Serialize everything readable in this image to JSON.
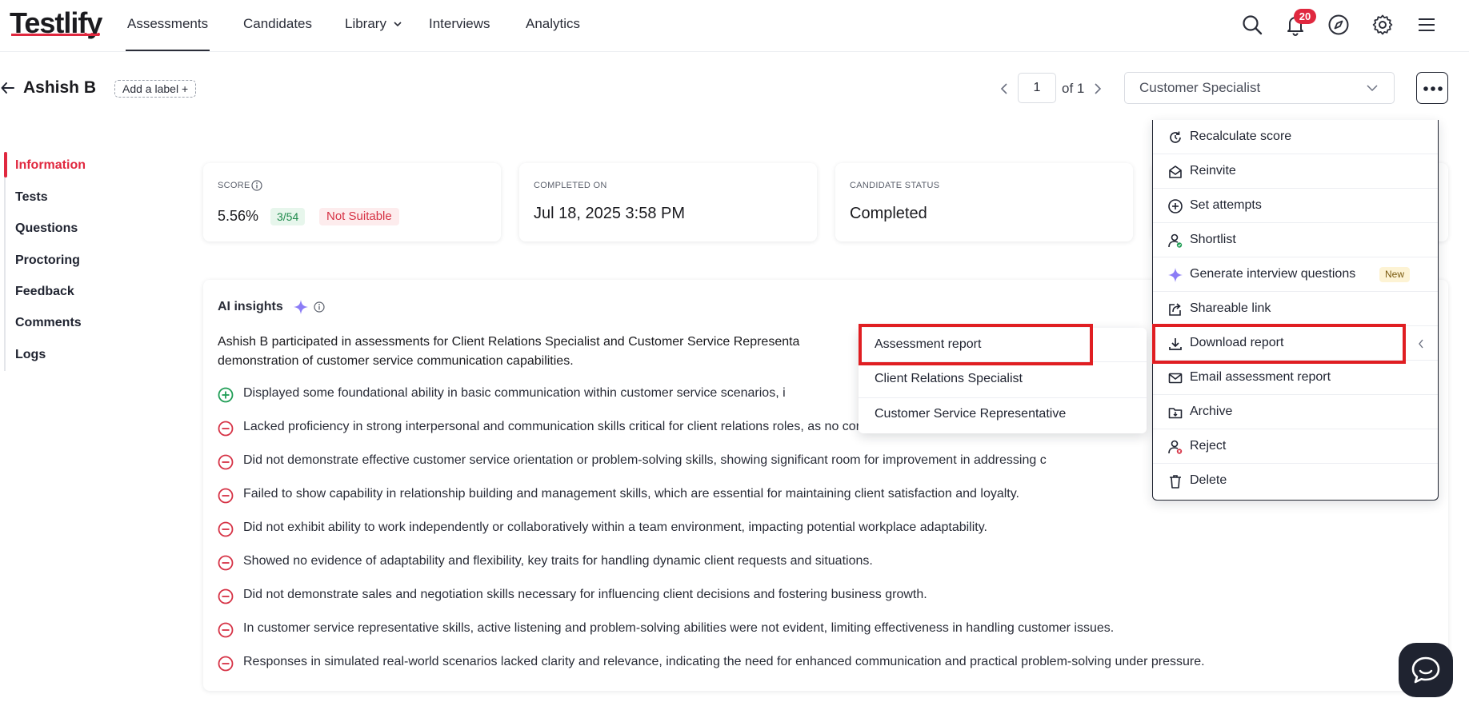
{
  "brand": {
    "name": "Testlify",
    "accent": "#e0283f"
  },
  "nav": {
    "items": [
      {
        "label": "Assessments",
        "active": true
      },
      {
        "label": "Candidates"
      },
      {
        "label": "Library"
      },
      {
        "label": "Interviews"
      },
      {
        "label": "Analytics"
      }
    ],
    "notifications_count": "20",
    "icons": [
      "search-icon",
      "bell-icon",
      "compass-icon",
      "gear-icon",
      "hamburger-menu-icon"
    ]
  },
  "header": {
    "candidate_name": "Ashish B",
    "add_label": "Add a label +",
    "pager": {
      "current": "1",
      "of_label": "of 1"
    },
    "role_select": "Customer Specialist"
  },
  "sidebar": {
    "items": [
      {
        "label": "Information",
        "active": true
      },
      {
        "label": "Tests"
      },
      {
        "label": "Questions"
      },
      {
        "label": "Proctoring"
      },
      {
        "label": "Feedback"
      },
      {
        "label": "Comments"
      },
      {
        "label": "Logs"
      }
    ]
  },
  "cards": {
    "score": {
      "label": "SCORE",
      "value": "5.56%",
      "ratio": "3/54",
      "status": "Not Suitable"
    },
    "completed_on": {
      "label": "COMPLETED ON",
      "value": "Jul 18, 2025 3:58 PM"
    },
    "candidate_status": {
      "label": "CANDIDATE STATUS",
      "value": "Completed"
    }
  },
  "insights": {
    "title": "AI insights",
    "summary_line1": "Ashish B participated in assessments for Client Relations Specialist and Customer Service Representa",
    "summary_line2": "demonstration of customer service communication capabilities.",
    "items": [
      {
        "type": "positive",
        "text": "Displayed some foundational ability in basic communication within customer service scenarios, i"
      },
      {
        "type": "negative",
        "text": "Lacked proficiency in strong interpersonal and communication skills critical for client relations roles, as no correct answers were recorded."
      },
      {
        "type": "negative",
        "text": "Did not demonstrate effective customer service orientation or problem-solving skills, showing significant room for improvement in addressing c"
      },
      {
        "type": "negative",
        "text": "Failed to show capability in relationship building and management skills, which are essential for maintaining client satisfaction and loyalty."
      },
      {
        "type": "negative",
        "text": "Did not exhibit ability to work independently or collaboratively within a team environment, impacting potential workplace adaptability."
      },
      {
        "type": "negative",
        "text": "Showed no evidence of adaptability and flexibility, key traits for handling dynamic client requests and situations."
      },
      {
        "type": "negative",
        "text": "Did not demonstrate sales and negotiation skills necessary for influencing client decisions and fostering business growth."
      },
      {
        "type": "negative",
        "text": "In customer service representative skills, active listening and problem-solving abilities were not evident, limiting effectiveness in handling customer issues."
      },
      {
        "type": "negative",
        "text": "Responses in simulated real-world scenarios lacked clarity and relevance, indicating the need for enhanced communication and practical problem-solving under pressure."
      }
    ]
  },
  "menu": {
    "items": [
      {
        "label": "Recalculate score",
        "icon": "recalculate-icon"
      },
      {
        "label": "Reinvite",
        "icon": "mail-open-icon"
      },
      {
        "label": "Set attempts",
        "icon": "plus-circle-icon"
      },
      {
        "label": "Shortlist",
        "icon": "user-check-icon"
      },
      {
        "label": "Generate interview questions",
        "icon": "sparkle-icon",
        "badge": "New"
      },
      {
        "label": "Shareable link",
        "icon": "share-icon"
      },
      {
        "label": "Download report",
        "icon": "download-icon"
      },
      {
        "label": "Email assessment report",
        "icon": "mail-icon"
      },
      {
        "label": "Archive",
        "icon": "archive-folder-icon"
      },
      {
        "label": "Reject",
        "icon": "user-x-icon"
      },
      {
        "label": "Delete",
        "icon": "trash-icon"
      }
    ]
  },
  "submenu": {
    "items": [
      {
        "label": "Assessment report"
      },
      {
        "label": "Client Relations Specialist"
      },
      {
        "label": "Customer Service Representative"
      }
    ]
  },
  "colors": {
    "highlight": "#e01e22",
    "positive": "#1f9d55",
    "negative": "#d63245",
    "sparkle": "#8b7cf6"
  }
}
